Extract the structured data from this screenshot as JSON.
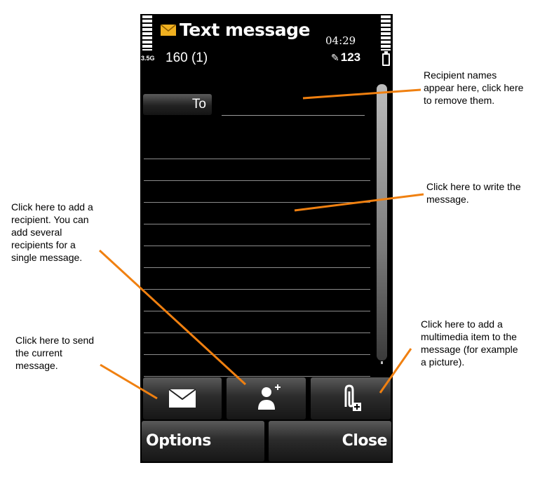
{
  "screen": {
    "title": "Text message",
    "clock": "04:29",
    "network": "3.5G",
    "char_counter": "160 (1)",
    "input_mode": "123",
    "to_label": "To",
    "options_label": "Options",
    "close_label": "Close"
  },
  "annotations": {
    "recipient_names": "Recipient names appear here, click here to remove them.",
    "write_message": "Click here to write the message.",
    "add_recipient": "Click here to add a recipient. You can add several recipients for a single message.",
    "send_message": "Click here to send the current message.",
    "add_multimedia": "Click here to add a multimedia item to the message (for example a picture)."
  },
  "colors": {
    "annotation_line": "#f08010",
    "title_icon": "#f0b020"
  }
}
